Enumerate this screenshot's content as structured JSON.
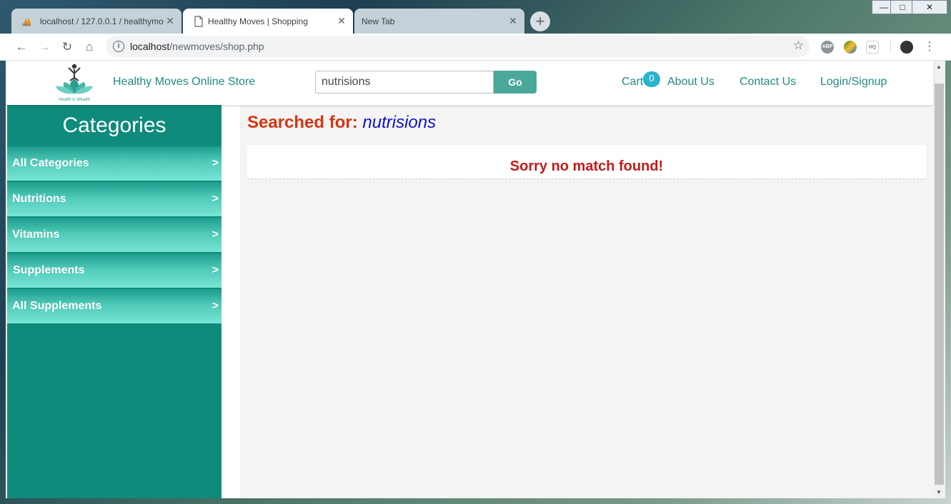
{
  "browser": {
    "tabs": [
      {
        "title": "localhost / 127.0.0.1 / healthymo",
        "favicon": "pma-icon",
        "active": false
      },
      {
        "title": "Healthy Moves | Shopping",
        "favicon": "page-icon",
        "active": true
      },
      {
        "title": "New Tab",
        "favicon": "",
        "active": false
      }
    ],
    "new_tab_label": "+",
    "address": {
      "host": "localhost",
      "path": "/newmoves/shop.php"
    },
    "extensions": [
      {
        "name": "adblock-icon",
        "label": "ABP"
      },
      {
        "name": "globe-extension-icon",
        "label": ""
      },
      {
        "name": "cloudhq-icon",
        "label": "HQ"
      }
    ]
  },
  "site": {
    "logo_caption": "Health is Wealth",
    "store_name": "Healthy Moves Online Store",
    "search": {
      "value": "nutrisions",
      "button_label": "Go"
    },
    "nav": {
      "cart_label": "Cart",
      "cart_count": "0",
      "about_label": "About Us",
      "contact_label": "Contact Us",
      "login_label": "Login/Signup"
    }
  },
  "sidebar": {
    "title": "Categories",
    "items": [
      {
        "label": "All Categories",
        "arrow": ">"
      },
      {
        "label": "Nutritions",
        "arrow": ">"
      },
      {
        "label": "Vitamins",
        "arrow": ">"
      },
      {
        "label": "Supplements",
        "arrow": ">"
      },
      {
        "label": "All Supplements",
        "arrow": ">"
      }
    ]
  },
  "main": {
    "heading_prefix": "Searched for: ",
    "search_term": "nutrisions",
    "no_match_message": "Sorry no match found!"
  },
  "colors": {
    "sidebar_bg": "#0e8b7b",
    "brand_text": "#218b80",
    "go_button": "#4aa89a",
    "heading_red": "#d43510",
    "term_blue": "#1010c8",
    "cart_badge": "#29b3cf"
  }
}
